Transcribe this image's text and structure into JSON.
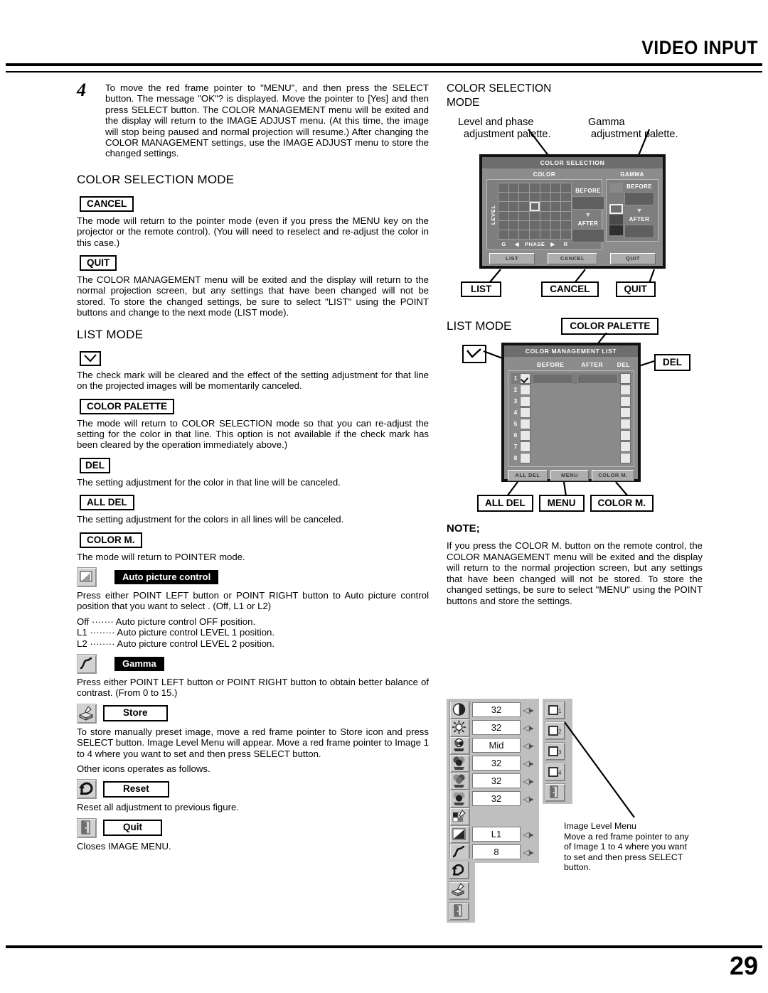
{
  "header": {
    "title": "VIDEO INPUT"
  },
  "footer": {
    "page_number": "29"
  },
  "left": {
    "step": {
      "number": "4",
      "text": "To move the red frame pointer to \"MENU\", and then press the SELECT button. The message \"OK\"? is displayed. Move the pointer to [Yes] and then press SELECT button. The COLOR MANAGEMENT menu will be exited and the display will return to the IMAGE ADJUST menu. (At this time, the image will stop being paused and normal projection will resume.) After changing the COLOR MANAGEMENT settings, use the IMAGE ADJUST menu to store the changed settings."
    },
    "color_selection_mode": {
      "heading": "COLOR SELECTION MODE",
      "cancel_label": "CANCEL",
      "cancel_text": "The mode will return to the pointer mode (even if you press the MENU key on the projector or the remote control). (You will need to reselect and re-adjust the color in this case.)",
      "quit_label": "QUIT",
      "quit_text": "The COLOR MANAGEMENT menu will be exited and the display will return to the normal projection screen, but any settings that have been changed will not be stored. To store the changed settings, be sure to select \"LIST\" using the POINT buttons and change to the next mode (LIST mode)."
    },
    "list_mode": {
      "heading": "LIST MODE",
      "check_text": "The check mark will be cleared and the effect of the setting adjustment for that line on the projected images will be momentarily canceled.",
      "color_palette_label": "COLOR PALETTE",
      "color_palette_text": "The mode will return to COLOR SELECTION mode so that you can re-adjust the setting for the color in that line. This option is not available if the check mark has been cleared by the operation immediately above.)",
      "del_label": "DEL",
      "del_text": "The setting adjustment for the color in that line will be canceled.",
      "all_del_label": "ALL DEL",
      "all_del_text": "The setting adjustment for the colors in all lines will be canceled.",
      "color_m_label": "COLOR M.",
      "color_m_text": "The mode will return to POINTER mode."
    },
    "auto_picture": {
      "tag": "Auto picture control",
      "text": "Press either POINT LEFT button or POINT RIGHT button to Auto picture control position that you want to select . (Off, L1 or L2)",
      "line_off": "Off ······· Auto picture control OFF position.",
      "line_l1": "L1 ········ Auto picture control LEVEL 1 position.",
      "line_l2": "L2 ········ Auto picture control LEVEL 2 position."
    },
    "gamma": {
      "tag": "Gamma",
      "text": "Press either POINT LEFT button or POINT RIGHT button to obtain better balance of contrast.  (From 0 to 15.)"
    },
    "store": {
      "tag": "Store",
      "text": "To store manually preset image, move a red frame pointer to Store icon and press SELECT button.  Image Level Menu will appear. Move a red frame pointer to Image 1 to 4 where you want to set and then press SELECT button.",
      "other": "Other icons operates as follows."
    },
    "reset": {
      "tag": "Reset",
      "text": "Reset all adjustment to previous figure."
    },
    "quit": {
      "tag": "Quit",
      "text": "Closes IMAGE MENU."
    }
  },
  "right": {
    "cs_heading_line1": "COLOR SELECTION",
    "cs_heading_line2": "MODE",
    "callout_level_line1": "Level and phase",
    "callout_level_line2": "adjustment palette.",
    "callout_gamma_line1": "Gamma",
    "callout_gamma_line2": "adjustment palette.",
    "color_selection_osd": {
      "title": "COLOR SELECTION",
      "color_header": "COLOR",
      "gamma_header": "GAMMA",
      "level_label": "LEVEL",
      "phase_left": "G",
      "phase_label": "PHASE",
      "phase_right": "R",
      "before_label": "BEFORE",
      "after_label": "AFTER",
      "buttons": [
        "LIST",
        "CANCEL",
        "QUIT"
      ]
    },
    "cs_callouts": [
      "LIST",
      "CANCEL",
      "QUIT"
    ],
    "list_mode_heading": "LIST MODE",
    "list_callout_color_palette": "COLOR PALETTE",
    "list_callout_del": "DEL",
    "cml_osd": {
      "title": "COLOR MANAGEMENT LIST",
      "col_before": "BEFORE",
      "col_after": "AFTER",
      "col_del": "DEL",
      "rows": [
        "1",
        "2",
        "3",
        "4",
        "5",
        "6",
        "7",
        "8"
      ],
      "buttons": [
        "ALL DEL",
        "MENU",
        "COLOR M."
      ]
    },
    "cml_callouts": [
      "ALL DEL",
      "MENU",
      "COLOR M."
    ],
    "note": {
      "heading": "NOTE;",
      "text": "If you press the COLOR M. button on the remote control, the COLOR MANAGEMENT menu will be exited and the display will return to the normal projection screen, but any settings that have been changed will not be stored. To store the changed settings, be sure to select \"MENU\" using the POINT buttons and store the settings."
    },
    "image_menu": {
      "values": [
        "32",
        "32",
        "Mid",
        "32",
        "32",
        "32",
        "",
        "L1",
        "8"
      ],
      "icons": [
        "contrast-icon",
        "brightness-icon",
        "color-temp-icon",
        "red-icon",
        "green-icon",
        "blue-icon",
        "color-management-icon",
        "auto-picture-control-icon",
        "gamma-icon",
        "reset-icon",
        "store-icon",
        "quit-icon"
      ]
    },
    "image_level_menu": {
      "items": [
        "1",
        "2",
        "3",
        "4"
      ],
      "caption_title": "Image Level Menu",
      "caption_l1": "Move a red frame pointer to any",
      "caption_l2": "of Image 1 to 4 where you want",
      "caption_l3": "to set  and then press SELECT",
      "caption_l4": "button."
    }
  }
}
